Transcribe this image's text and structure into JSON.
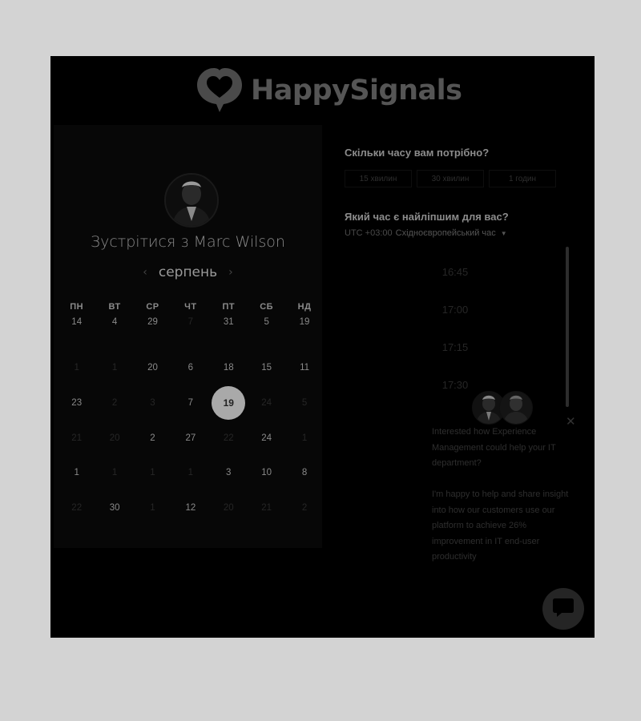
{
  "brand": {
    "name": "HappySignals"
  },
  "calendar": {
    "title": "Зустрітися з Marc Wilson",
    "month": "серпень",
    "prev_icon": "chevron-left-icon",
    "next_icon": "chevron-right-icon",
    "weekdays": [
      "ПН",
      "ВТ",
      "СР",
      "ЧТ",
      "ПТ",
      "СБ",
      "НД"
    ],
    "days": [
      {
        "label": "14",
        "available": true
      },
      {
        "label": "4",
        "available": true
      },
      {
        "label": "29",
        "available": true
      },
      {
        "label": "7",
        "available": false
      },
      {
        "label": "31",
        "available": true
      },
      {
        "label": "5",
        "available": true
      },
      {
        "label": "19",
        "available": true
      },
      {
        "label": "1",
        "available": false
      },
      {
        "label": "1",
        "available": false
      },
      {
        "label": "20",
        "available": true
      },
      {
        "label": "6",
        "available": true
      },
      {
        "label": "18",
        "available": true
      },
      {
        "label": "15",
        "available": true
      },
      {
        "label": "11",
        "available": true
      },
      {
        "label": "23",
        "available": true
      },
      {
        "label": "2",
        "available": false
      },
      {
        "label": "3",
        "available": false
      },
      {
        "label": "7",
        "available": true
      },
      {
        "label": "19",
        "available": true,
        "selected": true
      },
      {
        "label": "24",
        "available": false
      },
      {
        "label": "5",
        "available": false
      },
      {
        "label": "21",
        "available": false
      },
      {
        "label": "20",
        "available": false
      },
      {
        "label": "2",
        "available": true
      },
      {
        "label": "27",
        "available": true
      },
      {
        "label": "22",
        "available": false
      },
      {
        "label": "24",
        "available": true
      },
      {
        "label": "1",
        "available": false
      },
      {
        "label": "1",
        "available": true
      },
      {
        "label": "1",
        "available": false
      },
      {
        "label": "1",
        "available": false
      },
      {
        "label": "1",
        "available": false
      },
      {
        "label": "3",
        "available": true
      },
      {
        "label": "10",
        "available": true
      },
      {
        "label": "8",
        "available": true
      },
      {
        "label": "22",
        "available": false
      },
      {
        "label": "30",
        "available": true
      },
      {
        "label": "1",
        "available": false
      },
      {
        "label": "12",
        "available": true
      },
      {
        "label": "20",
        "available": false
      },
      {
        "label": "21",
        "available": false
      },
      {
        "label": "2",
        "available": false
      }
    ]
  },
  "booking": {
    "duration_question": "Скільки часу вам потрібно?",
    "durations": [
      "15 хвилин",
      "30 хвилин",
      "1 годин"
    ],
    "time_question": "Який час є найліпшим для вас?",
    "timezone_offset": "UTC +03:00",
    "timezone_name": "Східноєвропейський час",
    "timezone_icon": "chevron-down-icon",
    "slots": [
      "16:45",
      "17:00",
      "17:15",
      "17:30"
    ]
  },
  "chat": {
    "message_1": "Interested how Experience Management could help your IT department?",
    "message_2": "I'm happy to help and share insight into how our customers use our platform to achieve 26% improvement in IT end-user productivity",
    "close_icon": "close-icon",
    "launcher_icon": "chat-bubble-icon"
  }
}
